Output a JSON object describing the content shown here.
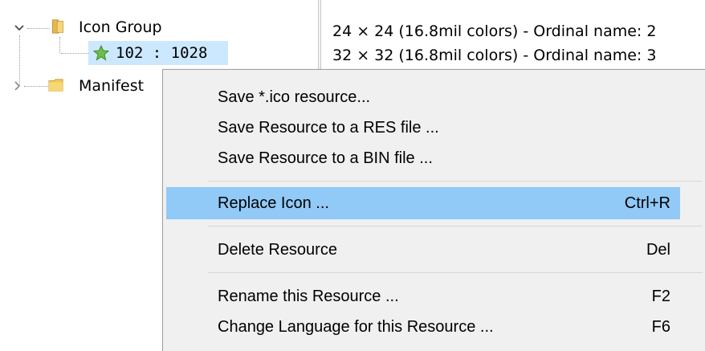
{
  "tree": {
    "nodes": [
      {
        "label": "Icon Group",
        "expanded": true
      },
      {
        "label": "Manifest",
        "expanded": false
      }
    ],
    "child": {
      "label": "102 : 1028",
      "selected": true
    }
  },
  "details": {
    "lines": [
      "24 × 24 (16.8mil colors) - Ordinal name: 2",
      "32 × 32 (16.8mil colors) - Ordinal name: 3"
    ]
  },
  "context_menu": {
    "items": [
      {
        "label": "Save *.ico resource...",
        "shortcut": ""
      },
      {
        "label": "Save Resource to a RES file ...",
        "shortcut": ""
      },
      {
        "label": "Save Resource to a BIN file ...",
        "shortcut": ""
      },
      {
        "label": "Replace Icon ...",
        "shortcut": "Ctrl+R",
        "highlighted": true
      },
      {
        "label": "Delete Resource",
        "shortcut": "Del"
      },
      {
        "label": "Rename this Resource ...",
        "shortcut": "F2"
      },
      {
        "label": "Change Language for this Resource ...",
        "shortcut": "F6"
      }
    ]
  },
  "colors": {
    "selection": "#cce8ff",
    "menu_highlight": "#91c9f7",
    "menu_background": "#f0f0f0"
  },
  "icons": [
    "chevron-down-icon",
    "chevron-right-icon",
    "folder-open-icon",
    "folder-icon",
    "star-icon"
  ]
}
